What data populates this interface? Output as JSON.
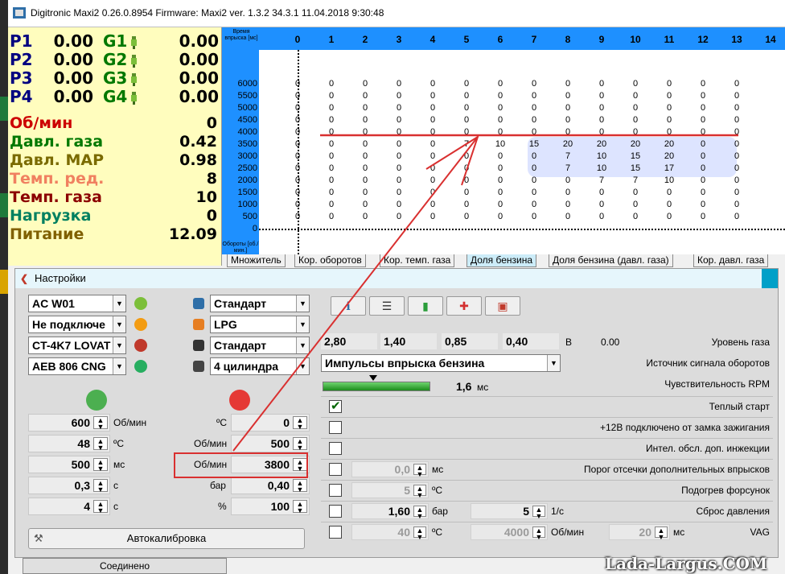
{
  "window": {
    "title": "Digitronic Maxi2 0.26.0.8954 Firmware: Maxi2  ver. 1.3.2  34.3.1  11.04.2018 9:30:48"
  },
  "pressures": [
    {
      "p": "P1",
      "pv": "0.00",
      "g": "G1",
      "gv": "0.00"
    },
    {
      "p": "P2",
      "pv": "0.00",
      "g": "G2",
      "gv": "0.00"
    },
    {
      "p": "P3",
      "pv": "0.00",
      "g": "G3",
      "gv": "0.00"
    },
    {
      "p": "P4",
      "pv": "0.00",
      "g": "G4",
      "gv": "0.00"
    }
  ],
  "sensors": [
    {
      "label": "Об/мин",
      "value": "0",
      "color": "#cc0000"
    },
    {
      "label": "Давл. газа",
      "value": "0.42",
      "color": "#007800"
    },
    {
      "label": "Давл. MAP",
      "value": "0.98",
      "color": "#7a6a00"
    },
    {
      "label": "Темп. ред.",
      "value": "8",
      "color": "#f08060"
    },
    {
      "label": "Темп. газа",
      "value": "10",
      "color": "#8b0000"
    },
    {
      "label": "Нагрузка",
      "value": "0",
      "color": "#008060"
    },
    {
      "label": "Питание",
      "value": "12.09",
      "color": "#806000"
    }
  ],
  "grid": {
    "header_label": "Время впрыска [мс]",
    "footer_label": "Обороты [об./мин.]",
    "columns": [
      "0",
      "1",
      "2",
      "3",
      "4",
      "5",
      "6",
      "7",
      "8",
      "9",
      "10",
      "11",
      "12",
      "13",
      "14"
    ],
    "rpm": [
      "6000",
      "5500",
      "5000",
      "4500",
      "4000",
      "3500",
      "3000",
      "2500",
      "2000",
      "1500",
      "1000",
      "500",
      "0"
    ],
    "rows": [
      [
        "0",
        "0",
        "0",
        "0",
        "0",
        "0",
        "0",
        "0",
        "0",
        "0",
        "0",
        "0",
        "0",
        "0"
      ],
      [
        "0",
        "0",
        "0",
        "0",
        "0",
        "0",
        "0",
        "0",
        "0",
        "0",
        "0",
        "0",
        "0",
        "0"
      ],
      [
        "0",
        "0",
        "0",
        "0",
        "0",
        "0",
        "0",
        "0",
        "0",
        "0",
        "0",
        "0",
        "0",
        "0"
      ],
      [
        "0",
        "0",
        "0",
        "0",
        "0",
        "0",
        "0",
        "0",
        "0",
        "0",
        "0",
        "0",
        "0",
        "0"
      ],
      [
        "0",
        "0",
        "0",
        "0",
        "0",
        "0",
        "0",
        "0",
        "0",
        "0",
        "0",
        "0",
        "0",
        "0"
      ],
      [
        "0",
        "0",
        "0",
        "0",
        "0",
        "7",
        "10",
        "15",
        "20",
        "20",
        "20",
        "20",
        "0",
        "0"
      ],
      [
        "0",
        "0",
        "0",
        "0",
        "0",
        "0",
        "0",
        "0",
        "7",
        "10",
        "15",
        "20",
        "0",
        "0"
      ],
      [
        "0",
        "0",
        "0",
        "0",
        "0",
        "0",
        "0",
        "0",
        "7",
        "10",
        "15",
        "17",
        "0",
        "0"
      ],
      [
        "0",
        "0",
        "0",
        "0",
        "0",
        "0",
        "0",
        "0",
        "0",
        "7",
        "7",
        "10",
        "0",
        "0"
      ],
      [
        "0",
        "0",
        "0",
        "0",
        "0",
        "0",
        "0",
        "0",
        "0",
        "0",
        "0",
        "0",
        "0",
        "0"
      ],
      [
        "0",
        "0",
        "0",
        "0",
        "0",
        "0",
        "0",
        "0",
        "0",
        "0",
        "0",
        "0",
        "0",
        "0"
      ],
      [
        "0",
        "0",
        "0",
        "0",
        "0",
        "0",
        "0",
        "0",
        "0",
        "0",
        "0",
        "0",
        "0",
        "0"
      ]
    ]
  },
  "tabs": [
    "Множитель",
    "Кор. оборотов",
    "Кор. темп. газа",
    "Доля бензина",
    "Доля бензина (давл. газа)",
    "Кор. давл. газа"
  ],
  "settings": {
    "title": "Настройки",
    "combos_left": [
      "AC W01",
      "Не подключе",
      "CT-4K7 LOVAT",
      "AEB 806 CNG"
    ],
    "combos_right": [
      "Стандарт",
      "LPG",
      "Стандарт",
      "4 цилиндра"
    ],
    "left_fields": [
      {
        "value": "600",
        "unit": "Об/мин"
      },
      {
        "value": "48",
        "unit": "ºC"
      },
      {
        "value": "500",
        "unit": "мс"
      },
      {
        "value": "0,3",
        "unit": "с"
      },
      {
        "value": "4",
        "unit": "с"
      }
    ],
    "right_fields": [
      {
        "label": "ºC",
        "value": "0"
      },
      {
        "label": "Об/мин",
        "value": "500"
      },
      {
        "label": "Об/мин",
        "value": "3800"
      },
      {
        "label": "бар",
        "value": "0,40"
      },
      {
        "label": "%",
        "value": "100"
      }
    ],
    "autocal": "Автокалибровка",
    "bottom_cut": "Соединено",
    "level_values": [
      "2,80",
      "1,40",
      "0,85",
      "0,40"
    ],
    "level_unit": "В",
    "level_reading": "0.00",
    "level_label": "Уровень газа",
    "rpm_source": "Импульсы впрыска бензина",
    "rpm_source_label": "Источник сигнала оборотов",
    "sensitivity_value": "1,6",
    "sensitivity_unit": "мс",
    "sensitivity_label": "Чувствительность RPM",
    "options": [
      {
        "label": "Теплый старт",
        "checked": true
      },
      {
        "label": "+12В подключено от замка зажигания",
        "checked": false
      },
      {
        "label": "Интел. обсл. доп. инжекции",
        "checked": false
      },
      {
        "label": "Порог отсечки дополнительных впрысков",
        "checked": false,
        "v1": "0,0",
        "u1": "мс"
      },
      {
        "label": "Подогрев форсунок",
        "checked": false,
        "v1": "5",
        "u1": "ºC"
      },
      {
        "label": "Сброс давления",
        "checked": false,
        "v1": "1,60",
        "u1": "бар",
        "v2": "5",
        "u2": "1/с"
      },
      {
        "label": "VAG",
        "checked": false,
        "v1": "40",
        "u1": "ºC",
        "v2": "4000",
        "u2": "Об/мин",
        "v3": "20",
        "u3": "мс"
      }
    ]
  },
  "watermark": "Lada-Largus.COM"
}
